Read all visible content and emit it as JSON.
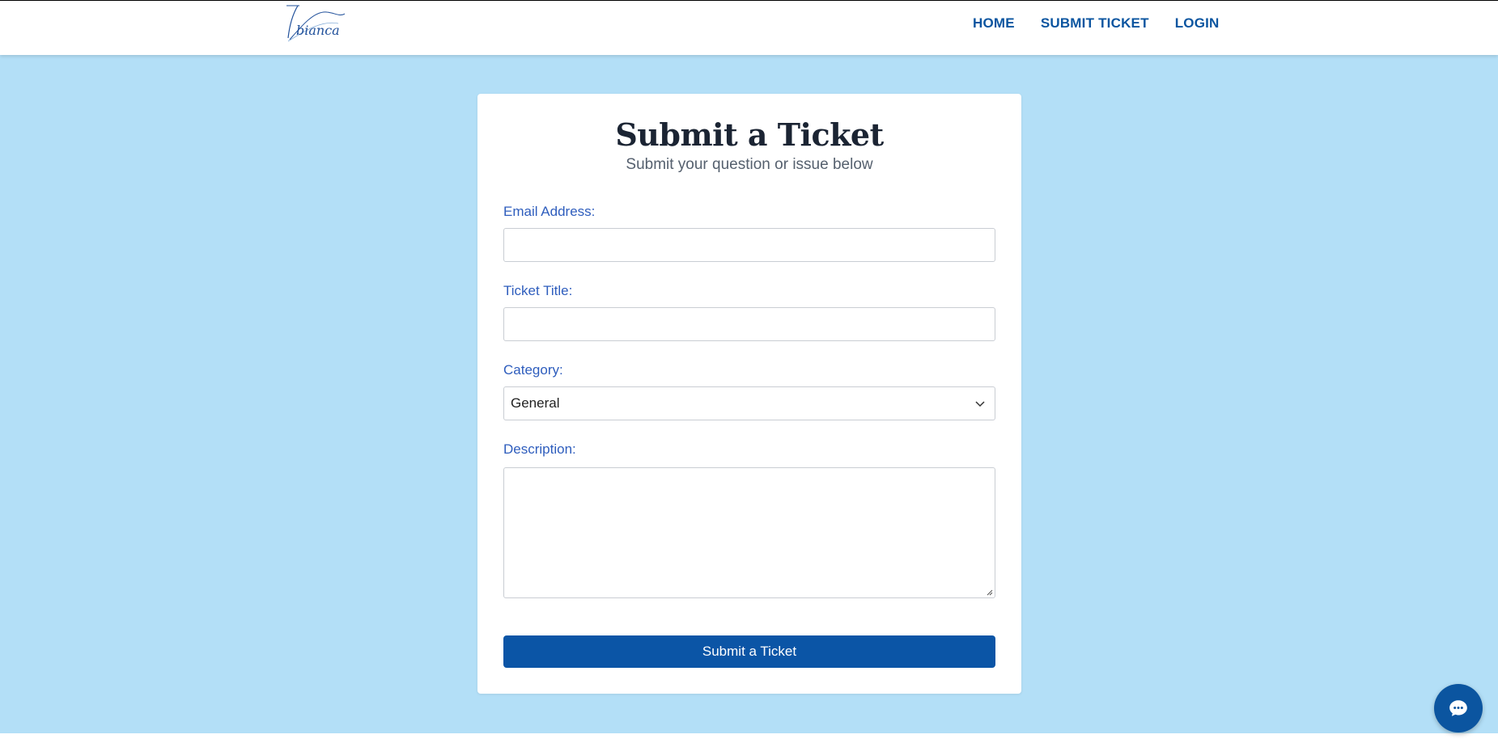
{
  "brand": {
    "logo_text": "bianca"
  },
  "nav": {
    "home": "HOME",
    "submit_ticket": "SUBMIT TICKET",
    "login": "LOGIN"
  },
  "form": {
    "title": "Submit a Ticket",
    "subtitle": "Submit your question or issue below",
    "email_label": "Email Address:",
    "email_value": "",
    "ticket_title_label": "Ticket Title:",
    "ticket_title_value": "",
    "category_label": "Category:",
    "category_selected": "General",
    "description_label": "Description:",
    "description_value": "",
    "submit_label": "Submit a Ticket"
  },
  "chat": {
    "icon": "chat-bubble-icon"
  },
  "colors": {
    "page_background": "#b3dff7",
    "accent": "#0b55a6",
    "label": "#2e5dbd",
    "title": "#1b2433"
  }
}
